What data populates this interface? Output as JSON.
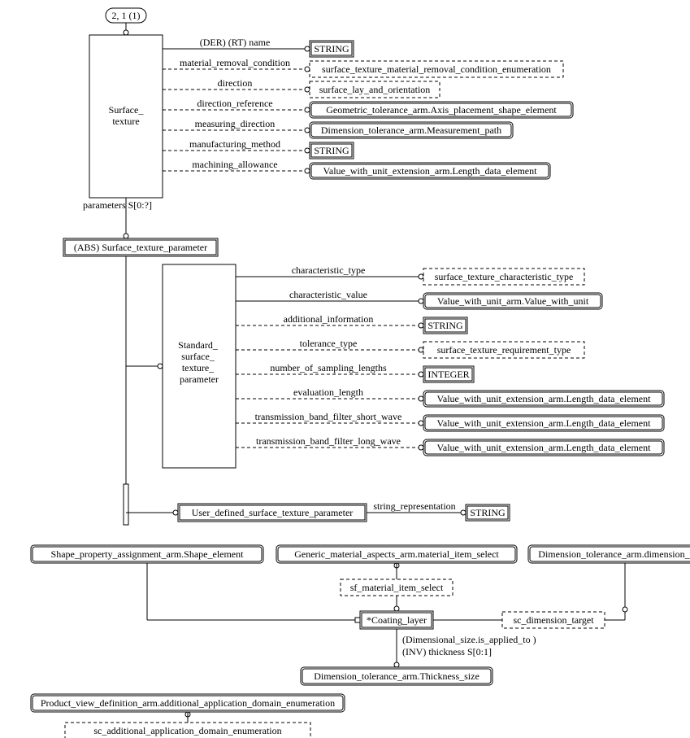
{
  "page_ref": "2, 1 (1)",
  "surface_texture": {
    "name": "Surface_\ntexture",
    "attrs": {
      "a1": "(DER) (RT) name",
      "a2": "material_removal_condition",
      "a3": "direction",
      "a4": "direction_reference",
      "a5": "measuring_direction",
      "a6": "manufacturing_method",
      "a7": "machining_allowance",
      "params": "parameters S[0:?]"
    },
    "types": {
      "t1": "STRING",
      "t2": "surface_texture_material_removal_condition_enumeration",
      "t3": "surface_lay_and_orientation",
      "t4": "Geometric_tolerance_arm.Axis_placement_shape_element",
      "t5": "Dimension_tolerance_arm.Measurement_path",
      "t6": "STRING",
      "t7": "Value_with_unit_extension_arm.Length_data_element"
    }
  },
  "abs_stp": "(ABS) Surface_texture_parameter",
  "sstp": {
    "name": "Standard_\nsurface_\ntexture_\nparameter",
    "attrs": {
      "a1": "characteristic_type",
      "a2": "characteristic_value",
      "a3": "additional_information",
      "a4": "tolerance_type",
      "a5": "number_of_sampling_lengths",
      "a6": "evaluation_length",
      "a7": "transmission_band_filter_short_wave",
      "a8": "transmission_band_filter_long_wave"
    },
    "types": {
      "t1": "surface_texture_characteristic_type",
      "t2": "Value_with_unit_arm.Value_with_unit",
      "t3": "STRING",
      "t4": "surface_texture_requirement_type",
      "t5": "INTEGER",
      "t6": "Value_with_unit_extension_arm.Length_data_element",
      "t7": "Value_with_unit_extension_arm.Length_data_element",
      "t8": "Value_with_unit_extension_arm.Length_data_element"
    }
  },
  "udstp": {
    "name": "User_defined_surface_texture_parameter",
    "attr": "string_representation",
    "type": "STRING"
  },
  "lower": {
    "spa": "Shape_property_assignment_arm.Shape_element",
    "gma": "Generic_material_aspects_arm.material_item_select",
    "dtd": "Dimension_tolerance_arm.dimension_target",
    "sfmis": "sf_material_item_select",
    "coating": "*Coating_layer",
    "scdt": "sc_dimension_target",
    "inv1": "(Dimensional_size.is_applied_to )",
    "inv2": "(INV) thickness S[0:1]",
    "dtt": "Dimension_tolerance_arm.Thickness_size",
    "pvd": "Product_view_definition_arm.additional_application_domain_enumeration",
    "scad": "sc_additional_application_domain_enumeration"
  }
}
